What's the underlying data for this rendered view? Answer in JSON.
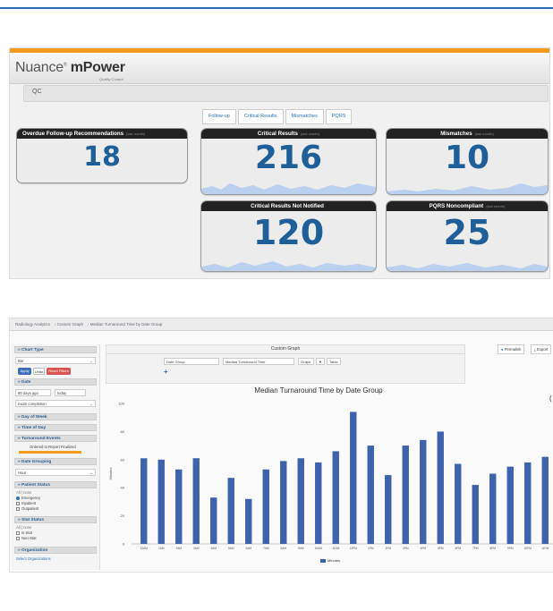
{
  "mpower": {
    "logo_brand": "Nuance",
    "logo_product": "mPower",
    "logo_sub": "Quality Control",
    "search_value": "QC",
    "tabs": [
      "Follow-up",
      "Critical Results",
      "Mismatches",
      "PQRS"
    ],
    "cards": [
      {
        "title": "Overdue Follow-up Recommendations",
        "sub": "(last month)",
        "value": "18"
      },
      {
        "title": "Critical Results",
        "sub": "(last month)",
        "value": "216"
      },
      {
        "title": "Mismatches",
        "sub": "(last month)",
        "value": "10"
      },
      {
        "title": "Critical Results Not Notified",
        "sub": "",
        "value": "120"
      },
      {
        "title": "PQRS Noncompliant",
        "sub": "(last month)",
        "value": "25"
      }
    ],
    "colors": {
      "accent": "#f39b1c",
      "number": "#1f5f99",
      "card_header": "#222222"
    }
  },
  "analytics": {
    "breadcrumb": [
      "Radiology Analytics",
      "Custom Graph",
      "Median Turnaround Time by Date Group"
    ],
    "sidebar": {
      "chart_type_label": "Chart Type",
      "chart_type_value": "Bar",
      "apply_label": "Apply",
      "undo_label": "Undo",
      "reset_label": "Reset Filters",
      "date_label": "Date",
      "date_from": "90 days ago",
      "date_to": "today",
      "date_field": "exam completion",
      "day_of_week": "Day of Week",
      "time_of_day": "Time of Day",
      "turnaround_events": "Turnaround Events",
      "turnaround_value": "Ordered to Report Finalized",
      "date_grouping": "Date Grouping",
      "date_grouping_value": "Hour",
      "patient_status": "Patient Status",
      "patient_status_sub": "All | none",
      "patient_options": [
        "Emergency",
        "Inpatient",
        "Outpatient"
      ],
      "stat_status": "Stat Status",
      "stat_status_sub": "All | none",
      "stat_options": [
        "Is Stat",
        "Non-Stat"
      ],
      "organization": "Organization",
      "organization_value": "Select Organizations"
    },
    "custom_graph": {
      "title": "Custom Graph",
      "group_by": "Date Group",
      "measure": "Median Turnaround Time",
      "graph_btn": "Graph",
      "table_btn": "Table"
    },
    "right_buttons": [
      "Permalink",
      "Export"
    ]
  },
  "chart_data": {
    "type": "bar",
    "title": "Median Turnaround Time by Date Group",
    "ylabel": "Minutes",
    "xlabel": "",
    "ylim": [
      0,
      100
    ],
    "yticks": [
      0,
      20,
      40,
      60,
      80,
      100
    ],
    "categories": [
      "12AM",
      "1AM",
      "2AM",
      "3AM",
      "4AM",
      "5AM",
      "6AM",
      "7AM",
      "8AM",
      "9AM",
      "10AM",
      "11AM",
      "12PM",
      "1PM",
      "2PM",
      "3PM",
      "4PM",
      "5PM",
      "6PM",
      "7PM",
      "8PM",
      "9PM",
      "10PM",
      "11PM"
    ],
    "series": [
      {
        "name": "Minutes",
        "color": "#3d63ad",
        "values": [
          61,
          60,
          53,
          61,
          33,
          47,
          32,
          53,
          59,
          61,
          58,
          66,
          94,
          70,
          49,
          70,
          74,
          80,
          57,
          42,
          50,
          55,
          58,
          62
        ]
      }
    ],
    "legend": "bottom-center",
    "grid": false
  }
}
